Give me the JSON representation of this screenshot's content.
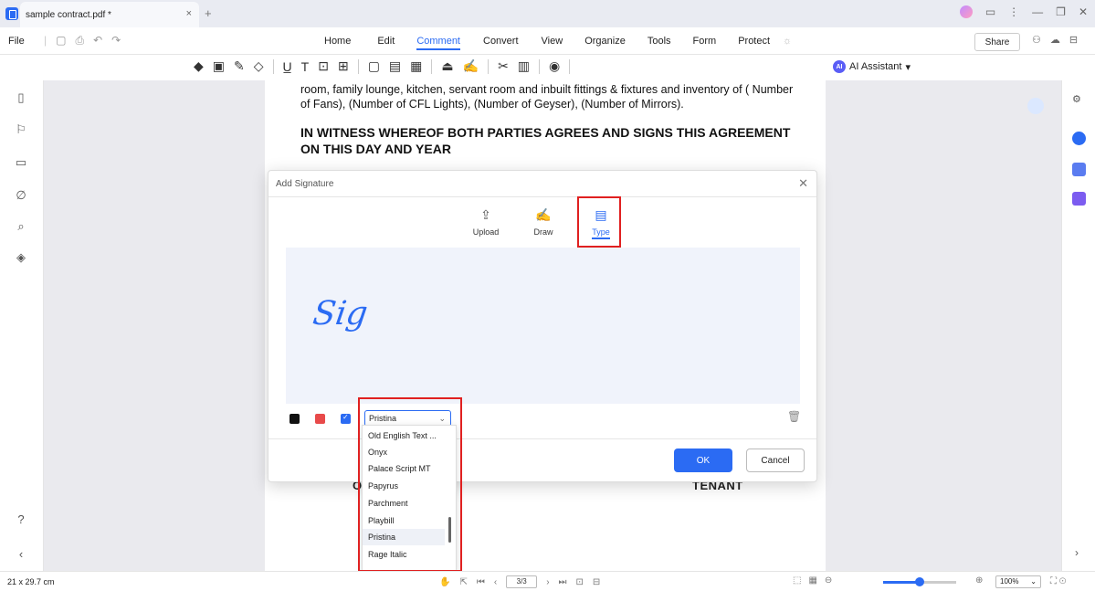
{
  "titlebar": {
    "doc_tab_title": "sample contract.pdf *",
    "close": "×",
    "new_tab": "+",
    "win_min": "—",
    "win_max": "❐",
    "win_close": "✕"
  },
  "menubar": {
    "file": "File",
    "items": [
      "Home",
      "Edit",
      "Comment",
      "Convert",
      "View",
      "Organize",
      "Tools",
      "Form",
      "Protect"
    ],
    "active_item": "Comment",
    "share": "Share"
  },
  "toolbar": {
    "ai_assistant": "AI Assistant",
    "ai_badge": "AI"
  },
  "document": {
    "paragraph": "room, family lounge, kitchen, servant room and inbuilt fittings & fixtures and inventory of ( Number of Fans), (Number of CFL Lights), (Number of Geyser), (Number of Mirrors).",
    "heading": "IN WITNESS WHEREOF BOTH PARTIES AGREES AND SIGNS THIS AGREEMENT ON THIS DAY AND YEAR",
    "owner_label": "O",
    "tenant_label": "TENANT"
  },
  "dialog": {
    "title": "Add Signature",
    "tabs": [
      {
        "label": "Upload",
        "icon": "upload-icon"
      },
      {
        "label": "Draw",
        "icon": "draw-icon"
      },
      {
        "label": "Type",
        "icon": "type-icon"
      }
    ],
    "active_tab": "Type",
    "signature_text": "Sig",
    "colors": {
      "black": "#111111",
      "red": "#e84a4a",
      "blue": "#2b6bf3"
    },
    "selected_color": "blue",
    "font_value": "Pristina",
    "ok": "OK",
    "cancel": "Cancel"
  },
  "font_options": [
    "Old English Text ...",
    "Onyx",
    "Palace Script MT",
    "Papyrus",
    "Parchment",
    "Playbill",
    "Pristina",
    "Rage Italic"
  ],
  "selected_font": "Pristina",
  "statusbar": {
    "page_size": "21 x 29.7 cm",
    "page_indicator": "3/3",
    "zoom": "100%",
    "zoom_level": 0.5
  }
}
